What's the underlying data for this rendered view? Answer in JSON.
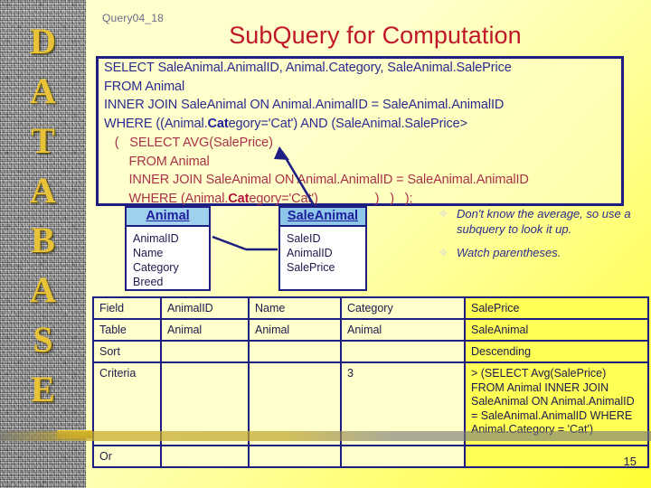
{
  "slide": {
    "query_tag": "Query04_18",
    "title": "SubQuery for Computation",
    "slide_number": "15",
    "sidebar_word": "DATABASE",
    "colors": {
      "title": "#c0182a",
      "sql_text": "#2b2b8f",
      "sql_subquery_text": "#a8324a",
      "border": "#1d1d82",
      "background_light": "#ffffcc",
      "background_bright": "#ffff33",
      "sidebar_letter": "#e8c33a",
      "entity_header": "#9fd0ee",
      "highlight_column": "#ffff55"
    }
  },
  "sql": {
    "lines": [
      {
        "text": "SELECT SaleAnimal.AnimalID, Animal.Category, SaleAnimal.SalePrice",
        "style": "main"
      },
      {
        "text": "FROM Animal",
        "style": "main"
      },
      {
        "text": "INNER JOIN SaleAnimal ON Animal.AnimalID = SaleAnimal.AnimalID",
        "style": "main"
      },
      {
        "text": "WHERE ((Animal.Category='Cat') AND (SaleAnimal.SalePrice>",
        "style": "main",
        "bold_token": "Cat"
      },
      {
        "text": "   (   SELECT AVG(SalePrice)",
        "style": "sub"
      },
      {
        "text": "       FROM Animal",
        "style": "sub"
      },
      {
        "text": "       INNER JOIN SaleAnimal ON Animal.AnimalID = SaleAnimal.AnimalID",
        "style": "sub"
      },
      {
        "text": "       WHERE (Animal.Category='Cat')                )   )   );",
        "style": "sub",
        "bold_token": "Cat"
      }
    ]
  },
  "entities": [
    {
      "name": "Animal",
      "fields": [
        "AnimalID",
        "Name",
        "Category",
        "Breed"
      ]
    },
    {
      "name": "SaleAnimal",
      "fields": [
        "SaleID",
        "AnimalID",
        "SalePrice"
      ]
    }
  ],
  "bullets": {
    "glyph": "✧",
    "items": [
      "Don't know the average, so use a subquery to look it up.",
      "Watch parentheses."
    ]
  },
  "qbe": {
    "rows": [
      {
        "label": "Field",
        "cells": [
          "AnimalID",
          "Name",
          "Category",
          "SalePrice"
        ]
      },
      {
        "label": "Table",
        "cells": [
          "Animal",
          "Animal",
          "Animal",
          "SaleAnimal"
        ]
      },
      {
        "label": "Sort",
        "cells": [
          "",
          "",
          "",
          "Descending"
        ]
      },
      {
        "label": "Criteria",
        "cells": [
          "",
          "",
          "3",
          "> (SELECT Avg(SalePrice) FROM Animal INNER JOIN SaleAnimal ON Animal.AnimalID = SaleAnimal.AnimalID WHERE Animal.Category = 'Cat')"
        ]
      },
      {
        "label": "Or",
        "cells": [
          "",
          "",
          "",
          ""
        ]
      }
    ]
  }
}
